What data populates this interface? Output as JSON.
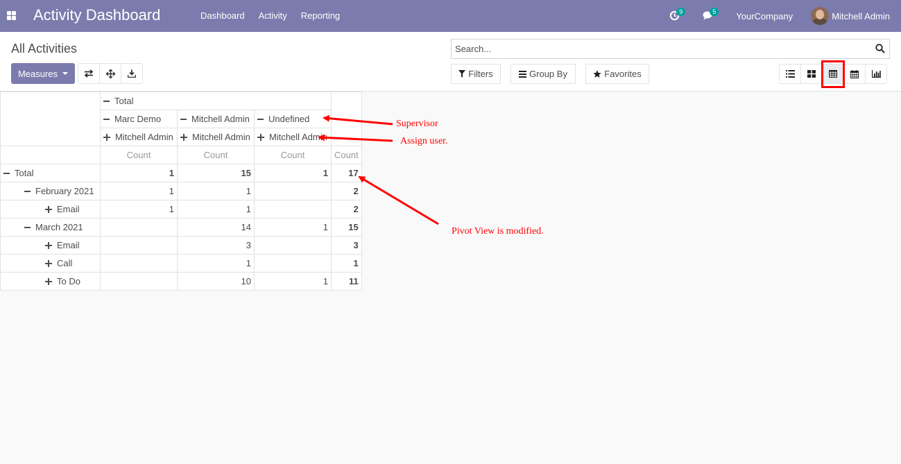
{
  "navbar": {
    "brand": "Activity Dashboard",
    "menu": [
      {
        "label": "Dashboard"
      },
      {
        "label": "Activity"
      },
      {
        "label": "Reporting"
      }
    ],
    "activity_badge": "9",
    "messages_badge": "5",
    "company": "YourCompany",
    "user": "Mitchell Admin"
  },
  "control": {
    "breadcrumb": "All Activities",
    "measures_label": "Measures",
    "search_placeholder": "Search...",
    "filters_label": "Filters",
    "groupby_label": "Group By",
    "favorites_label": "Favorites",
    "active_view": "pivot"
  },
  "pivot": {
    "header_total": "Total",
    "supervisors": [
      "Marc Demo",
      "Mitchell Admin",
      "Undefined"
    ],
    "assignees": [
      "Mitchell Admin",
      "Mitchell Admin",
      "Mitchell Admin"
    ],
    "measure": "Count",
    "rows": [
      {
        "label": "Total",
        "level": 0,
        "toggle": "minus",
        "values": [
          "1",
          "15",
          "1"
        ],
        "total": "17",
        "bold": true
      },
      {
        "label": "February 2021",
        "level": 1,
        "toggle": "minus",
        "values": [
          "1",
          "1",
          ""
        ],
        "total": "2",
        "bold": false
      },
      {
        "label": "Email",
        "level": 2,
        "toggle": "plus",
        "values": [
          "1",
          "1",
          ""
        ],
        "total": "2",
        "bold": false
      },
      {
        "label": "March 2021",
        "level": 1,
        "toggle": "minus",
        "values": [
          "",
          "14",
          "1"
        ],
        "total": "15",
        "bold": false
      },
      {
        "label": "Email",
        "level": 2,
        "toggle": "plus",
        "values": [
          "",
          "3",
          ""
        ],
        "total": "3",
        "bold": false
      },
      {
        "label": "Call",
        "level": 2,
        "toggle": "plus",
        "values": [
          "",
          "1",
          ""
        ],
        "total": "1",
        "bold": false
      },
      {
        "label": "To Do",
        "level": 2,
        "toggle": "plus",
        "values": [
          "",
          "10",
          "1"
        ],
        "total": "11",
        "bold": false
      }
    ]
  },
  "annotations": {
    "supervisor": "Supervisor",
    "assign_user": "Assign user.",
    "pivot_modified": "Pivot View is modified."
  },
  "colors": {
    "brand": "#7c7bad",
    "badge": "#00a09d",
    "annotation": "#ff0000"
  }
}
